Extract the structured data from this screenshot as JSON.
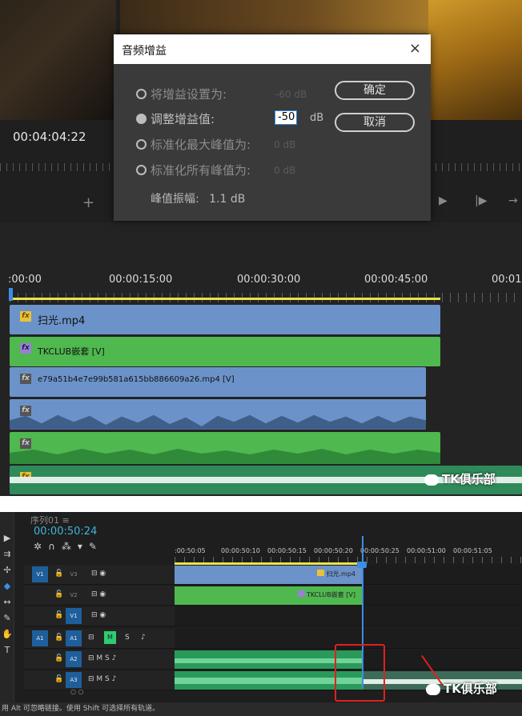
{
  "panel1": {
    "monitor": {
      "timecode": "00:04:04:22",
      "plus_icon": "plus-icon",
      "controls": [
        "play-icon",
        "step-forward-icon",
        "insert-icon"
      ]
    },
    "dialog": {
      "title": "音频增益",
      "close_icon": "×",
      "options": [
        {
          "label": "将增益设置为:",
          "value": "-60 dB",
          "selected": false
        },
        {
          "label": "调整增益值:",
          "value": "-50",
          "unit": "dB",
          "selected": true
        },
        {
          "label": "标准化最大峰值为:",
          "value": "0 dB",
          "selected": false
        },
        {
          "label": "标准化所有峰值为:",
          "value": "0 dB",
          "selected": false
        }
      ],
      "ok_label": "确定",
      "cancel_label": "取消",
      "peak_label": "峰值振幅:",
      "peak_value": "1.1 dB"
    },
    "timeline": {
      "ruler": [
        ":00:00",
        "00:00:15:00",
        "00:00:30:00",
        "00:00:45:00",
        "00:01"
      ],
      "clips": [
        {
          "name": "扫光.mp4",
          "color": "#6b93c9",
          "fx": "fx"
        },
        {
          "name": "TKCLUB嵌套 [V]",
          "color": "#4fb84f",
          "fx": "fx"
        },
        {
          "name": "e79a51b4e7e99b581a615bb886609a26.mp4 [V]",
          "color": "#6b93c9",
          "fx": "fx"
        }
      ],
      "audio_fx": [
        "fx",
        "fx",
        "fx"
      ],
      "watermark": "TK俱乐部"
    }
  },
  "panel2": {
    "sequence_title": "序列01 ≡",
    "timecode": "00:00:50:24",
    "ruler": [
      ":00:50:05",
      "00:00:50:10",
      "00:00:50:15",
      "00:00:50:20",
      "00:00:50:25",
      "00:00:51:00",
      "00:00:51:05",
      "00:00:51"
    ],
    "tracks": [
      {
        "src": "V1",
        "tgt": "V3",
        "icons": "⊟ ◉"
      },
      {
        "src": "",
        "tgt": "V2",
        "icons": "⊟ ◉"
      },
      {
        "src": "",
        "tgt": "V1",
        "icons": "⊟ ◉"
      },
      {
        "src": "A1",
        "tgt": "A1",
        "icons": "⊟ M S ♪"
      },
      {
        "src": "",
        "tgt": "A2",
        "icons": "⊟ M S ♪"
      },
      {
        "src": "",
        "tgt": "A3",
        "icons": "⊟ M S ♪"
      }
    ],
    "mute_label": "M",
    "solo_label": "S",
    "clip_v3": "扫光.mp4",
    "clip_v2": "TKCLUB嵌套 [V]",
    "watermark": "TK俱乐部",
    "status": "用 Alt 可忽略链接。使用 Shift 可选择所有轨道。",
    "scroll_marks": "○ ○"
  }
}
